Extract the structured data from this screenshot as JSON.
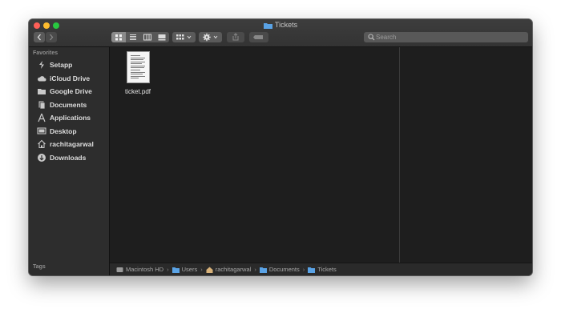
{
  "window": {
    "title": "Tickets"
  },
  "toolbar": {
    "back_icon": "chevron-left-icon",
    "forward_icon": "chevron-right-icon",
    "view_modes": [
      "icon-view",
      "list-view",
      "column-view",
      "gallery-view"
    ],
    "active_view": "icon-view",
    "search_placeholder": "Search"
  },
  "sidebar": {
    "favorites_heading": "Favorites",
    "items": [
      {
        "label": "Setapp",
        "icon": "setapp-icon"
      },
      {
        "label": "iCloud Drive",
        "icon": "cloud-icon"
      },
      {
        "label": "Google Drive",
        "icon": "folder-icon"
      },
      {
        "label": "Documents",
        "icon": "documents-icon"
      },
      {
        "label": "Applications",
        "icon": "applications-icon"
      },
      {
        "label": "Desktop",
        "icon": "desktop-icon"
      },
      {
        "label": "rachitagarwal",
        "icon": "home-icon"
      },
      {
        "label": "Downloads",
        "icon": "download-icon"
      }
    ],
    "tags_heading": "Tags"
  },
  "files": [
    {
      "name": "ticket.pdf",
      "icon": "pdf-document-icon"
    }
  ],
  "pathbar": {
    "items": [
      {
        "label": "Macintosh HD",
        "icon": "hard-drive-icon"
      },
      {
        "label": "Users",
        "icon": "folder-icon"
      },
      {
        "label": "rachitagarwal",
        "icon": "home-icon"
      },
      {
        "label": "Documents",
        "icon": "folder-icon"
      },
      {
        "label": "Tickets",
        "icon": "folder-icon"
      }
    ]
  },
  "colors": {
    "folder_blue": "#5aa3e6",
    "sidebar_bg": "#2d2d2d",
    "content_bg": "#1e1e1e",
    "close": "#fe5f57",
    "minimize": "#febc2e",
    "maximize": "#28c840"
  }
}
